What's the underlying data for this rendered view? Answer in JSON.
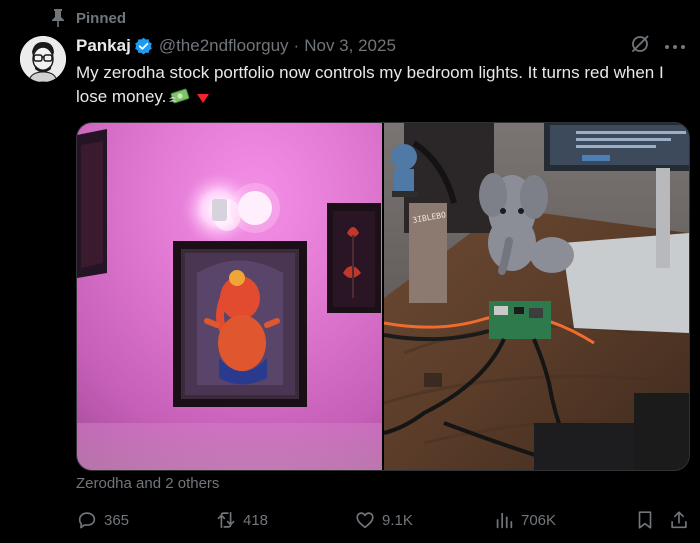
{
  "pinned_label": "Pinned",
  "author": {
    "name": "Pankaj",
    "handle": "@the2ndfloorguy",
    "separator": "·",
    "date": "Nov 3, 2025"
  },
  "tweet": {
    "text": "My zerodha stock portfolio now controls my bedroom lights. It turns red when I lose money.",
    "emojis": [
      "money-with-wings-icon",
      "down-triangle-icon"
    ]
  },
  "social_context": "Zerodha and 2 others",
  "actions": {
    "replies": "365",
    "reposts": "418",
    "likes": "9.1K",
    "views": "706K"
  },
  "colors": {
    "background": "#000000",
    "text": "#e7e9ea",
    "muted": "#71767b",
    "verified": "#1d9bf0",
    "border": "#2f3336",
    "down_triangle": "#f4212e"
  }
}
